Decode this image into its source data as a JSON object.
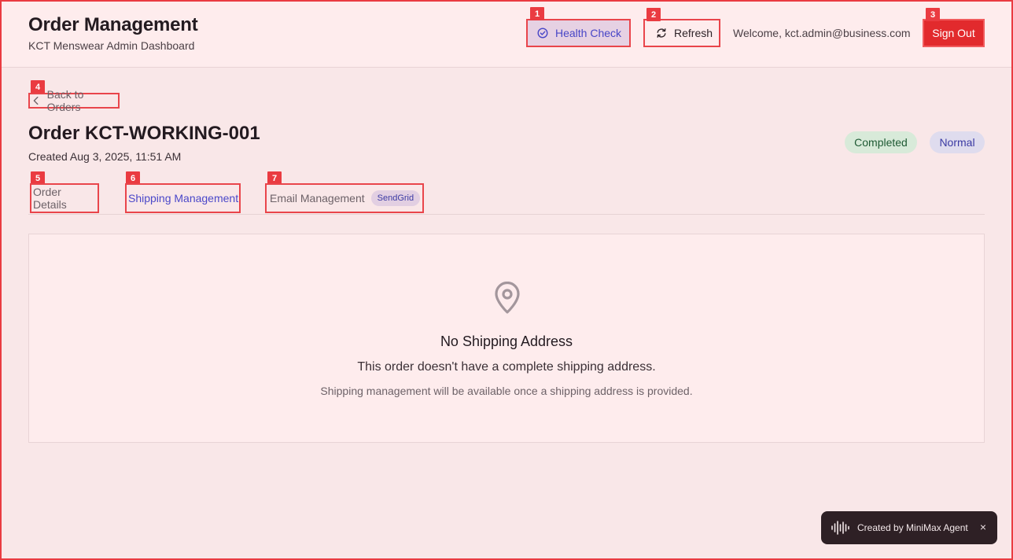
{
  "header": {
    "title": "Order Management",
    "subtitle": "KCT Menswear Admin Dashboard",
    "health_check_label": "Health Check",
    "refresh_label": "Refresh",
    "welcome_text": "Welcome, kct.admin@business.com",
    "sign_out_label": "Sign Out"
  },
  "markers": [
    "1",
    "2",
    "3",
    "4",
    "5",
    "6",
    "7"
  ],
  "back_link_label": "Back to Orders",
  "order": {
    "title": "Order KCT-WORKING-001",
    "created": "Created Aug 3, 2025, 11:51 AM",
    "status_badge": "Completed",
    "priority_badge": "Normal"
  },
  "tabs": [
    {
      "label": "Order Details",
      "active": false
    },
    {
      "label": "Shipping Management",
      "active": true
    },
    {
      "label": "Email Management",
      "active": false,
      "pill": "SendGrid"
    }
  ],
  "empty_state": {
    "icon": "map-pin-icon",
    "title": "No Shipping Address",
    "description": "This order doesn't have a complete shipping address.",
    "note": "Shipping management will be available once a shipping address is provided."
  },
  "toast": {
    "icon": "audio-wave-icon",
    "text": "Created by MiniMax Agent",
    "close": "×"
  },
  "colors": {
    "page_bg": "#f9e7e8",
    "header_bg": "#feeced",
    "accent": "#4b48c9",
    "danger": "#e22a2d",
    "highlight_border": "#ea3b41"
  }
}
